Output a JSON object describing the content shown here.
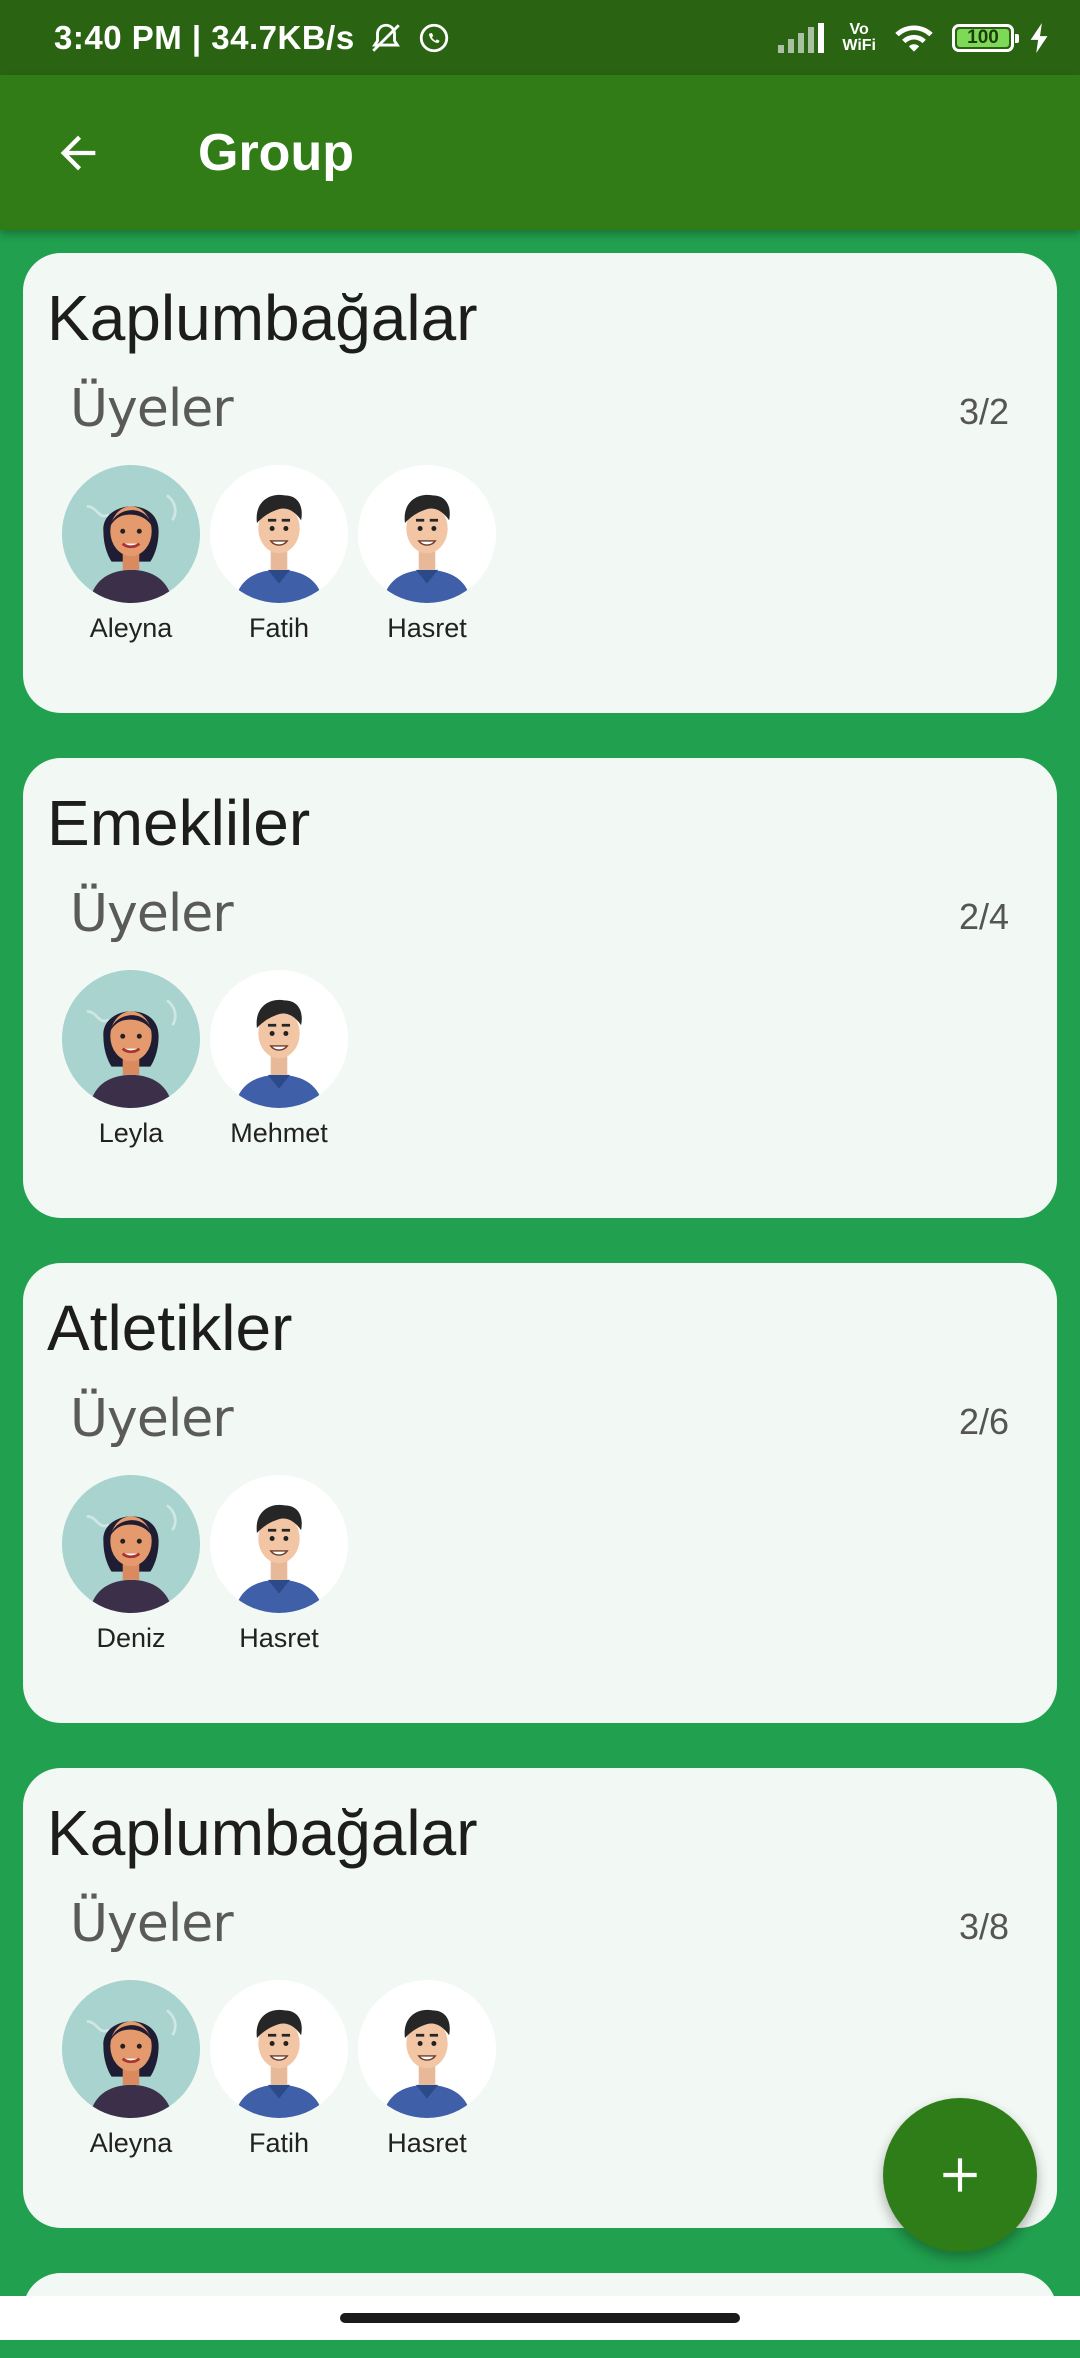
{
  "status_bar": {
    "time_speed": "3:40 PM | 34.7KB/s",
    "icons": [
      "mute-alarm-icon",
      "whatsapp-icon",
      "signal-icon",
      "wifi-icon",
      "charging-icon"
    ],
    "vowifi_top": "Vo",
    "vowifi_bottom": "WiFi",
    "battery": "100"
  },
  "app_bar": {
    "title": "Group",
    "back_icon": "arrow-left-icon"
  },
  "groups": [
    {
      "name": "Kaplumbağalar",
      "members_label": "Üyeler",
      "count": "3/2",
      "members": [
        {
          "name": "Aleyna",
          "avatar": "female"
        },
        {
          "name": "Fatih",
          "avatar": "male"
        },
        {
          "name": "Hasret",
          "avatar": "male"
        }
      ]
    },
    {
      "name": "Emekliler",
      "members_label": "Üyeler",
      "count": "2/4",
      "members": [
        {
          "name": "Leyla",
          "avatar": "female"
        },
        {
          "name": "Mehmet",
          "avatar": "male"
        }
      ]
    },
    {
      "name": "Atletikler",
      "members_label": "Üyeler",
      "count": "2/6",
      "members": [
        {
          "name": "Deniz",
          "avatar": "female"
        },
        {
          "name": "Hasret",
          "avatar": "male"
        }
      ]
    },
    {
      "name": "Kaplumbağalar",
      "members_label": "Üyeler",
      "count": "3/8",
      "members": [
        {
          "name": "Aleyna",
          "avatar": "female"
        },
        {
          "name": "Fatih",
          "avatar": "male"
        },
        {
          "name": "Hasret",
          "avatar": "male"
        }
      ]
    }
  ],
  "fab": {
    "icon": "plus-icon"
  },
  "colors": {
    "background": "#21a04f",
    "app_bar": "#327c17",
    "status_bar": "#2a6413",
    "card": "#f2f8f3",
    "fab": "#2f7d18"
  }
}
